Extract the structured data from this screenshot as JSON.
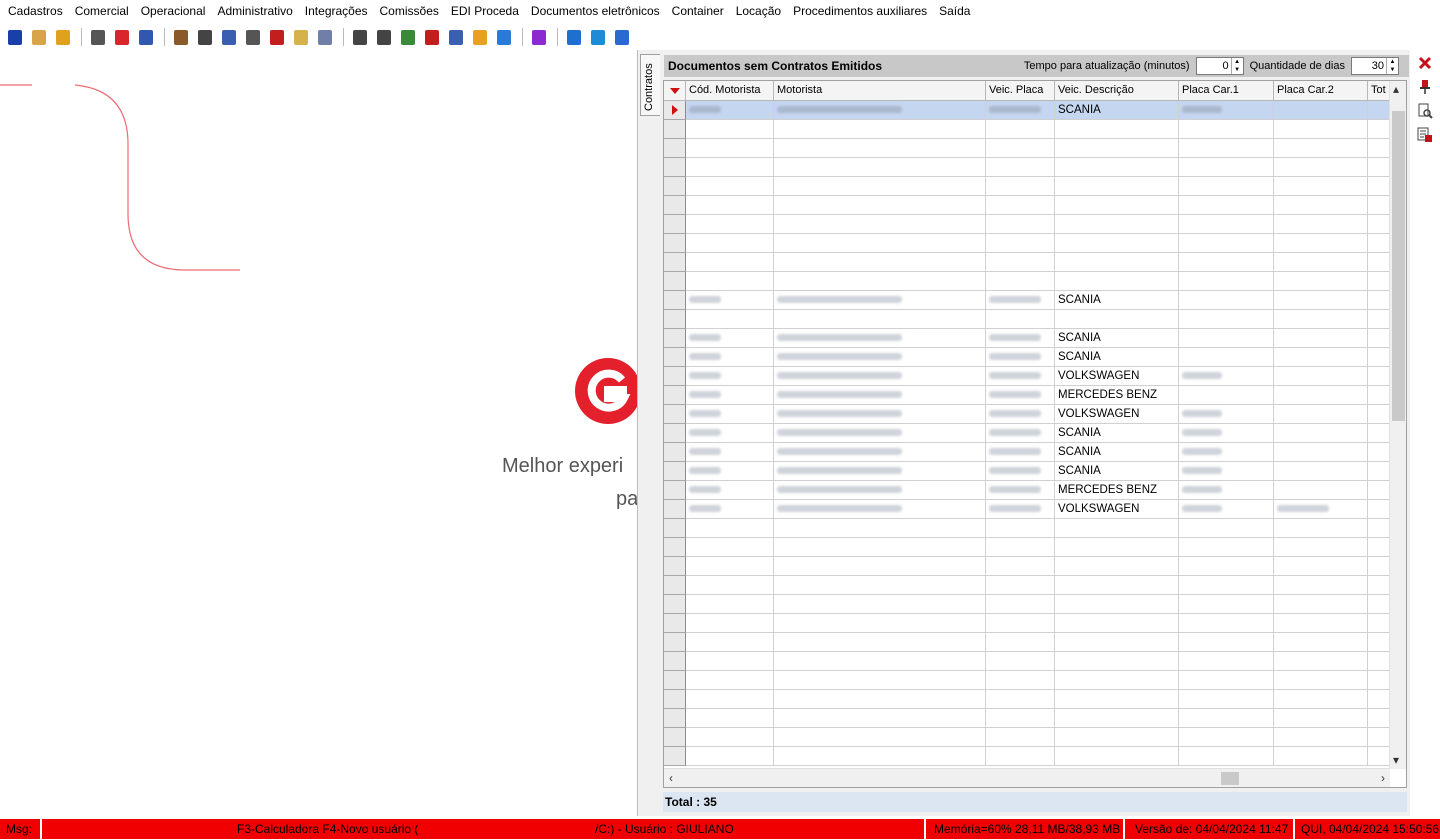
{
  "menu": [
    "Cadastros",
    "Comercial",
    "Operacional",
    "Administrativo",
    "Integrações",
    "Comissões",
    "EDI Proceda",
    "Documentos eletrônicos",
    "Container",
    "Locação",
    "Procedimentos auxiliares",
    "Saída"
  ],
  "toolbar": {
    "groups": [
      [
        {
          "icon": "arrow-down-icon",
          "color": "#1b3fa8"
        },
        {
          "icon": "users-icon",
          "color": "#d7a44a"
        },
        {
          "icon": "window-icon",
          "color": "#e0a020"
        }
      ],
      [
        {
          "icon": "calculator-icon",
          "color": "#555555"
        },
        {
          "icon": "parking-icon",
          "color": "#d9262b"
        },
        {
          "icon": "book-icon",
          "color": "#3058b0"
        }
      ],
      [
        {
          "icon": "truck-icon",
          "color": "#8a5a2a"
        },
        {
          "icon": "document-icon",
          "color": "#444444"
        },
        {
          "icon": "documents-icon",
          "color": "#3a5fb0"
        },
        {
          "icon": "printer-list-icon",
          "color": "#555555"
        },
        {
          "icon": "cube-icon",
          "color": "#c21e1e"
        },
        {
          "icon": "clipboard-icon",
          "color": "#d6b24a"
        },
        {
          "icon": "handshake-icon",
          "color": "#6f7fa8"
        }
      ],
      [
        {
          "icon": "preview-icon",
          "color": "#444444"
        },
        {
          "icon": "report-icon",
          "color": "#444444"
        },
        {
          "icon": "report-chart-icon",
          "color": "#3a8a3a"
        },
        {
          "icon": "report-export-icon",
          "color": "#c21e1e"
        },
        {
          "icon": "print-icon",
          "color": "#3a5fb0"
        },
        {
          "icon": "pie-chart-icon",
          "color": "#e8a020"
        },
        {
          "icon": "bell-icon",
          "color": "#2a7ad8"
        }
      ],
      [
        {
          "icon": "monitor-icon",
          "color": "#8a2ad0"
        }
      ],
      [
        {
          "icon": "tools-icon",
          "color": "#1f6fcf"
        },
        {
          "icon": "app-logo-icon",
          "color": "#1e8bd6"
        },
        {
          "icon": "file-blue-icon",
          "color": "#2a6ad0"
        }
      ]
    ]
  },
  "brand": {
    "tagline": "Melhor experi",
    "tagline2": "pa",
    "accent": "#e3202b"
  },
  "panel": {
    "side_tab": "Contratos",
    "title": "Documentos sem Contratos Emitidos",
    "refresh_label": "Tempo para atualização (minutos)",
    "refresh_value": "0",
    "days_label": "Quantidade de dias",
    "days_value": "30",
    "columns": [
      "Cód. Motorista",
      "Motorista",
      "Veic. Placa",
      "Veic. Descrição",
      "Placa Car.1",
      "Placa Car.2",
      "Tot"
    ],
    "rows": [
      {
        "desc": "SCANIA",
        "hidden": [
          true,
          true,
          true,
          false,
          true,
          false
        ],
        "selected": true
      },
      {
        "desc": "",
        "hidden": [
          false,
          false,
          false,
          false,
          false,
          false
        ]
      },
      {
        "desc": "",
        "hidden": [
          false,
          false,
          false,
          false,
          false,
          false
        ]
      },
      {
        "desc": "",
        "hidden": [
          false,
          false,
          false,
          false,
          false,
          false
        ]
      },
      {
        "desc": "",
        "hidden": [
          false,
          false,
          false,
          false,
          false,
          false
        ]
      },
      {
        "desc": "",
        "hidden": [
          false,
          false,
          false,
          false,
          false,
          false
        ]
      },
      {
        "desc": "",
        "hidden": [
          false,
          false,
          false,
          false,
          false,
          false
        ]
      },
      {
        "desc": "",
        "hidden": [
          false,
          false,
          false,
          false,
          false,
          false
        ]
      },
      {
        "desc": "",
        "hidden": [
          false,
          false,
          false,
          false,
          false,
          false
        ]
      },
      {
        "desc": "",
        "hidden": [
          false,
          false,
          false,
          false,
          false,
          false
        ]
      },
      {
        "desc": "SCANIA",
        "hidden": [
          true,
          true,
          true,
          false,
          false,
          false
        ]
      },
      {
        "desc": "",
        "hidden": [
          false,
          false,
          false,
          false,
          false,
          false
        ]
      },
      {
        "desc": "SCANIA",
        "hidden": [
          true,
          true,
          true,
          false,
          false,
          false
        ]
      },
      {
        "desc": "SCANIA",
        "hidden": [
          true,
          true,
          true,
          false,
          false,
          false
        ]
      },
      {
        "desc": "VOLKSWAGEN",
        "hidden": [
          true,
          true,
          true,
          false,
          true,
          false
        ]
      },
      {
        "desc": "MERCEDES BENZ",
        "hidden": [
          true,
          true,
          true,
          false,
          false,
          false
        ]
      },
      {
        "desc": "VOLKSWAGEN",
        "hidden": [
          true,
          true,
          true,
          false,
          true,
          false
        ]
      },
      {
        "desc": "SCANIA",
        "hidden": [
          true,
          true,
          true,
          false,
          true,
          false
        ]
      },
      {
        "desc": "SCANIA",
        "hidden": [
          true,
          true,
          true,
          false,
          true,
          false
        ]
      },
      {
        "desc": "SCANIA",
        "hidden": [
          true,
          true,
          true,
          false,
          true,
          false
        ]
      },
      {
        "desc": "MERCEDES BENZ",
        "hidden": [
          true,
          true,
          true,
          false,
          true,
          false
        ]
      },
      {
        "desc": "VOLKSWAGEN",
        "hidden": [
          true,
          true,
          true,
          false,
          true,
          true
        ]
      }
    ],
    "empty_rows": 13,
    "total": "Total : 35"
  },
  "right_icons": [
    "close-icon",
    "pin-icon",
    "preview-icon",
    "export-icon"
  ],
  "status": {
    "msg_label": "Msg:",
    "shortcuts": "F3-Calculadora F4-Novo usuário (",
    "path_user": "/C:) - Usuário : GIULIANO",
    "memory": "Memória=60% 28,11 MB/38,93 MB",
    "version": "Versão de: 04/04/2024 11:47",
    "datetime": "QUI, 04/04/2024 15:50:56"
  }
}
